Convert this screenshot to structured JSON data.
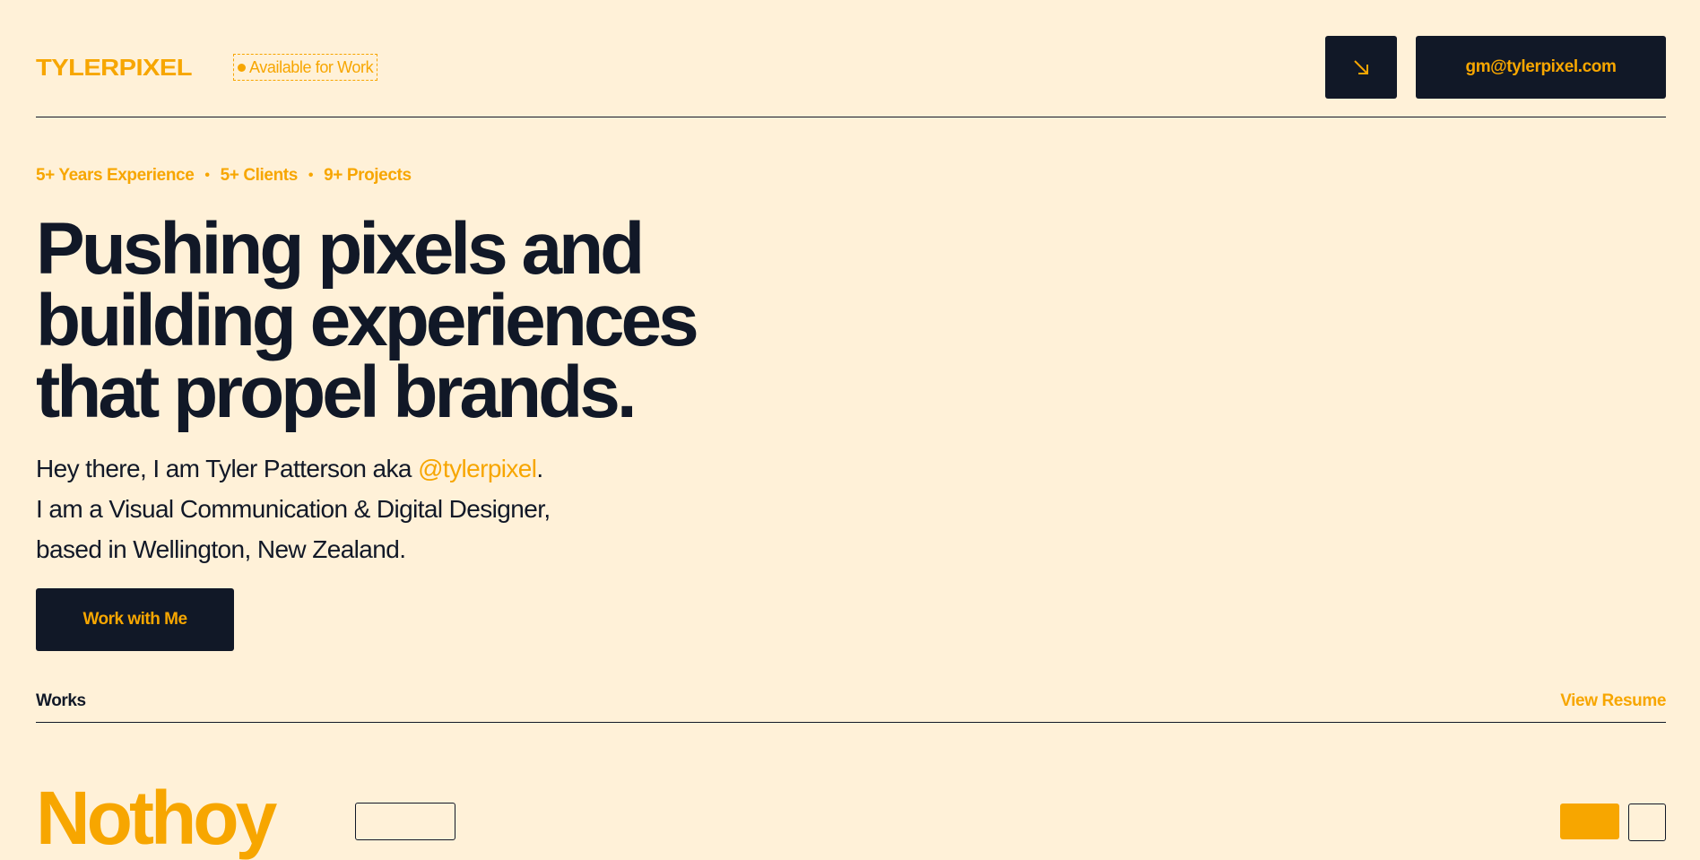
{
  "header": {
    "logo": "TYLERPIXEL",
    "availability": "Available for Work",
    "arrow_icon": "arrow-down-right-icon",
    "email": "gm@tylerpixel.com"
  },
  "hero": {
    "stats": [
      "5+ Years Experience",
      "5+ Clients",
      "9+ Projects"
    ],
    "stat_separator": "•",
    "headline": [
      "Pushing pixels and",
      "building experiences",
      "that propel brands."
    ],
    "intro_line1_prefix": "Hey there, I am Tyler Patterson aka ",
    "intro_handle": "@tylerpixel",
    "intro_line1_suffix": ".",
    "intro_line2": "I am a Visual Communication & Digital Designer,",
    "intro_line3": "based in Wellington, New Zealand.",
    "cta": "Work with Me"
  },
  "works": {
    "label": "Works",
    "resume_link": "View Resume",
    "first_project_title": "Nothoy"
  },
  "colors": {
    "background": "#fff1d8",
    "accent": "#f7a600",
    "dark": "#111827"
  }
}
